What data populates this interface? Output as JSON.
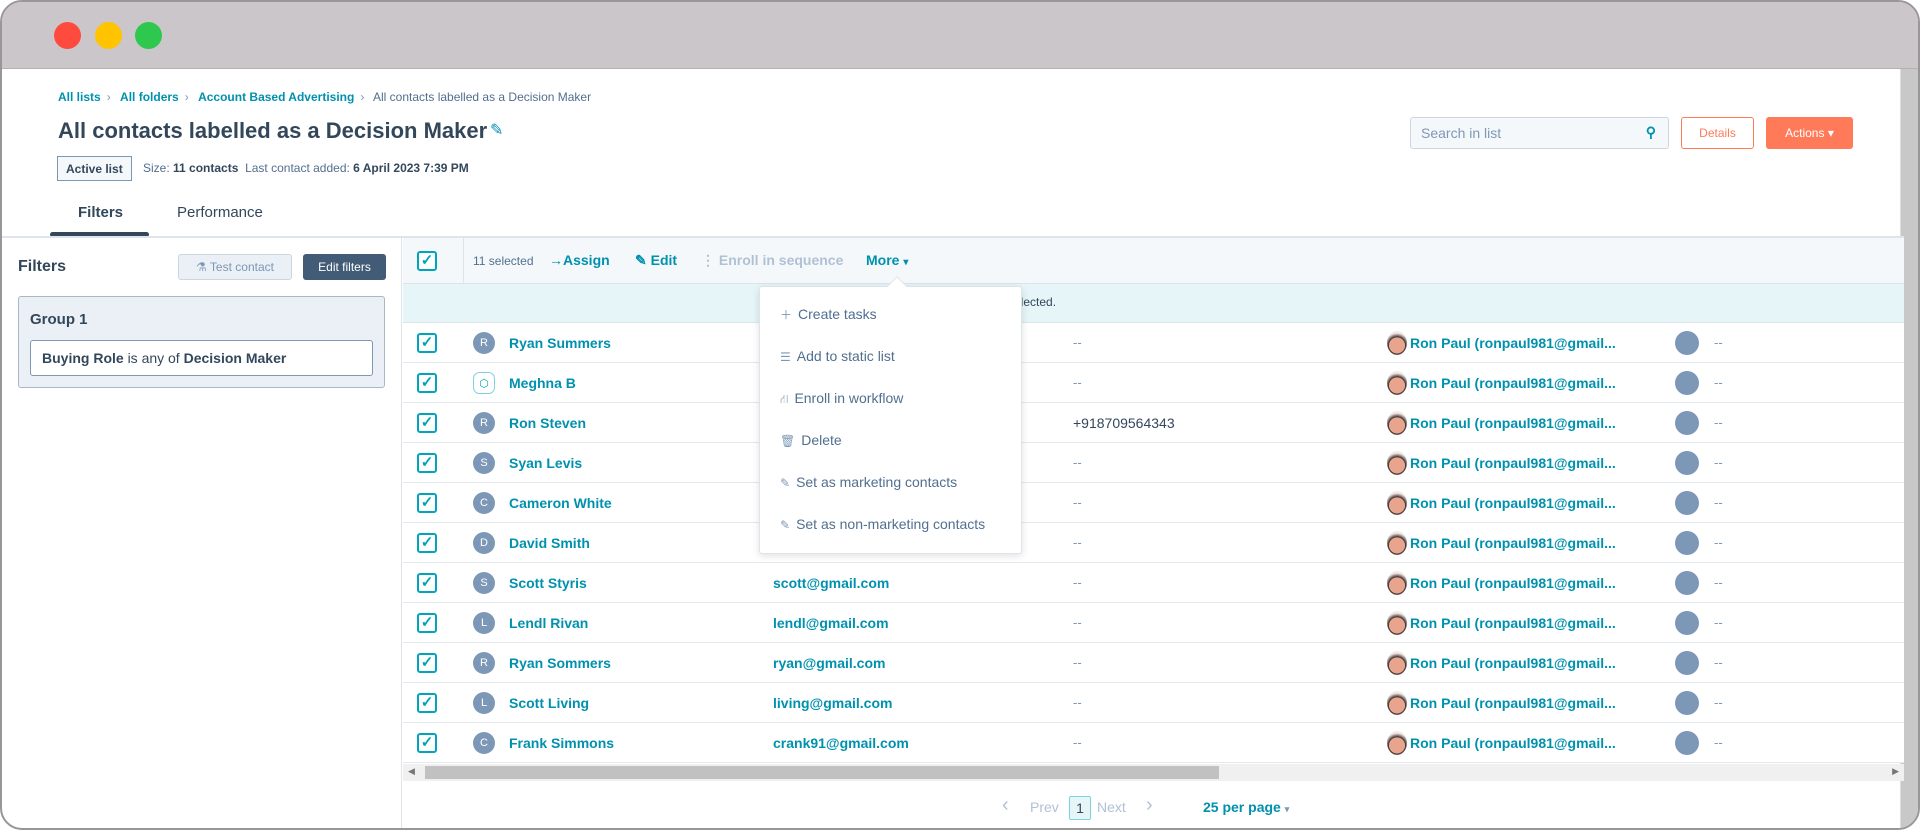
{
  "window": {
    "traffic_lights": [
      "#ff4b3e",
      "#ffc300",
      "#2dc84d"
    ]
  },
  "breadcrumb": [
    "All lists",
    "All folders",
    "Account Based Advertising",
    "All contacts labelled as a Decision Maker"
  ],
  "page": {
    "title": "All contacts labelled as a Decision Maker",
    "badge": "Active list",
    "size_label": "Size:",
    "size_value": "11 contacts",
    "last_label": "Last contact added:",
    "last_value": "6 April 2023 7:39 PM"
  },
  "tabs": [
    "Filters",
    "Performance"
  ],
  "header": {
    "search_placeholder": "Search in list",
    "details": "Details",
    "actions": "Actions"
  },
  "filters": {
    "title": "Filters",
    "test_contact": "Test contact",
    "edit_filters": "Edit filters",
    "group_title": "Group 1",
    "rule_property": "Buying Role",
    "rule_operator": "is any of",
    "rule_value": "Decision Maker"
  },
  "toolbar": {
    "selected": "11 selected",
    "assign": "Assign",
    "edit": "Edit",
    "enroll": "Enroll in sequence",
    "more": "More",
    "info": "selected."
  },
  "menu": [
    "Create tasks",
    "Add to static list",
    "Enroll in workflow",
    "Delete",
    "Set as marketing contacts",
    "Set as non-marketing contacts"
  ],
  "rows": [
    {
      "initial": "R",
      "name": "Ryan Summers",
      "email": "",
      "phone": "--",
      "owner": "Ron Paul (ronpaul981@gmail...",
      "extra": "--"
    },
    {
      "initial": "",
      "name": "Meghna B",
      "email": "",
      "phone": "--",
      "owner": "Ron Paul (ronpaul981@gmail...",
      "extra": "--"
    },
    {
      "initial": "R",
      "name": "Ron Steven",
      "email": "",
      "phone": "+918709564343",
      "owner": "Ron Paul (ronpaul981@gmail...",
      "extra": "--"
    },
    {
      "initial": "S",
      "name": "Syan Levis",
      "email": "",
      "phone": "--",
      "owner": "Ron Paul (ronpaul981@gmail...",
      "extra": "--"
    },
    {
      "initial": "C",
      "name": "Cameron White",
      "email": "",
      "phone": "--",
      "owner": "Ron Paul (ronpaul981@gmail...",
      "extra": "--"
    },
    {
      "initial": "D",
      "name": "David Smith",
      "email": "",
      "phone": "--",
      "owner": "Ron Paul (ronpaul981@gmail...",
      "extra": "--"
    },
    {
      "initial": "S",
      "name": "Scott Styris",
      "email": "scott@gmail.com",
      "phone": "--",
      "owner": "Ron Paul (ronpaul981@gmail...",
      "extra": "--"
    },
    {
      "initial": "L",
      "name": "Lendl Rivan",
      "email": "lendl@gmail.com",
      "phone": "--",
      "owner": "Ron Paul (ronpaul981@gmail...",
      "extra": "--"
    },
    {
      "initial": "R",
      "name": "Ryan Sommers",
      "email": "ryan@gmail.com",
      "phone": "--",
      "owner": "Ron Paul (ronpaul981@gmail...",
      "extra": "--"
    },
    {
      "initial": "L",
      "name": "Scott Living",
      "email": "living@gmail.com",
      "phone": "--",
      "owner": "Ron Paul (ronpaul981@gmail...",
      "extra": "--"
    },
    {
      "initial": "C",
      "name": "Frank Simmons",
      "email": "crank91@gmail.com",
      "phone": "--",
      "owner": "Ron Paul (ronpaul981@gmail...",
      "extra": "--"
    }
  ],
  "pagination": {
    "prev": "Prev",
    "page": "1",
    "next": "Next",
    "per_page": "25 per page"
  }
}
